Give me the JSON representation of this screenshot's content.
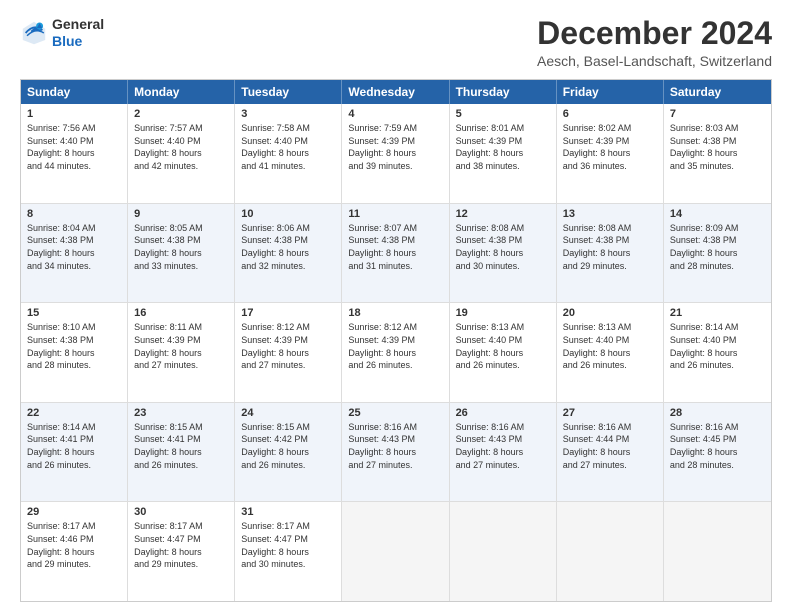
{
  "logo": {
    "line1": "General",
    "line2": "Blue"
  },
  "title": "December 2024",
  "subtitle": "Aesch, Basel-Landschaft, Switzerland",
  "weekdays": [
    "Sunday",
    "Monday",
    "Tuesday",
    "Wednesday",
    "Thursday",
    "Friday",
    "Saturday"
  ],
  "weeks": [
    [
      {
        "day": "1",
        "lines": [
          "Sunrise: 7:56 AM",
          "Sunset: 4:40 PM",
          "Daylight: 8 hours",
          "and 44 minutes."
        ]
      },
      {
        "day": "2",
        "lines": [
          "Sunrise: 7:57 AM",
          "Sunset: 4:40 PM",
          "Daylight: 8 hours",
          "and 42 minutes."
        ]
      },
      {
        "day": "3",
        "lines": [
          "Sunrise: 7:58 AM",
          "Sunset: 4:40 PM",
          "Daylight: 8 hours",
          "and 41 minutes."
        ]
      },
      {
        "day": "4",
        "lines": [
          "Sunrise: 7:59 AM",
          "Sunset: 4:39 PM",
          "Daylight: 8 hours",
          "and 39 minutes."
        ]
      },
      {
        "day": "5",
        "lines": [
          "Sunrise: 8:01 AM",
          "Sunset: 4:39 PM",
          "Daylight: 8 hours",
          "and 38 minutes."
        ]
      },
      {
        "day": "6",
        "lines": [
          "Sunrise: 8:02 AM",
          "Sunset: 4:39 PM",
          "Daylight: 8 hours",
          "and 36 minutes."
        ]
      },
      {
        "day": "7",
        "lines": [
          "Sunrise: 8:03 AM",
          "Sunset: 4:38 PM",
          "Daylight: 8 hours",
          "and 35 minutes."
        ]
      }
    ],
    [
      {
        "day": "8",
        "lines": [
          "Sunrise: 8:04 AM",
          "Sunset: 4:38 PM",
          "Daylight: 8 hours",
          "and 34 minutes."
        ]
      },
      {
        "day": "9",
        "lines": [
          "Sunrise: 8:05 AM",
          "Sunset: 4:38 PM",
          "Daylight: 8 hours",
          "and 33 minutes."
        ]
      },
      {
        "day": "10",
        "lines": [
          "Sunrise: 8:06 AM",
          "Sunset: 4:38 PM",
          "Daylight: 8 hours",
          "and 32 minutes."
        ]
      },
      {
        "day": "11",
        "lines": [
          "Sunrise: 8:07 AM",
          "Sunset: 4:38 PM",
          "Daylight: 8 hours",
          "and 31 minutes."
        ]
      },
      {
        "day": "12",
        "lines": [
          "Sunrise: 8:08 AM",
          "Sunset: 4:38 PM",
          "Daylight: 8 hours",
          "and 30 minutes."
        ]
      },
      {
        "day": "13",
        "lines": [
          "Sunrise: 8:08 AM",
          "Sunset: 4:38 PM",
          "Daylight: 8 hours",
          "and 29 minutes."
        ]
      },
      {
        "day": "14",
        "lines": [
          "Sunrise: 8:09 AM",
          "Sunset: 4:38 PM",
          "Daylight: 8 hours",
          "and 28 minutes."
        ]
      }
    ],
    [
      {
        "day": "15",
        "lines": [
          "Sunrise: 8:10 AM",
          "Sunset: 4:38 PM",
          "Daylight: 8 hours",
          "and 28 minutes."
        ]
      },
      {
        "day": "16",
        "lines": [
          "Sunrise: 8:11 AM",
          "Sunset: 4:39 PM",
          "Daylight: 8 hours",
          "and 27 minutes."
        ]
      },
      {
        "day": "17",
        "lines": [
          "Sunrise: 8:12 AM",
          "Sunset: 4:39 PM",
          "Daylight: 8 hours",
          "and 27 minutes."
        ]
      },
      {
        "day": "18",
        "lines": [
          "Sunrise: 8:12 AM",
          "Sunset: 4:39 PM",
          "Daylight: 8 hours",
          "and 26 minutes."
        ]
      },
      {
        "day": "19",
        "lines": [
          "Sunrise: 8:13 AM",
          "Sunset: 4:40 PM",
          "Daylight: 8 hours",
          "and 26 minutes."
        ]
      },
      {
        "day": "20",
        "lines": [
          "Sunrise: 8:13 AM",
          "Sunset: 4:40 PM",
          "Daylight: 8 hours",
          "and 26 minutes."
        ]
      },
      {
        "day": "21",
        "lines": [
          "Sunrise: 8:14 AM",
          "Sunset: 4:40 PM",
          "Daylight: 8 hours",
          "and 26 minutes."
        ]
      }
    ],
    [
      {
        "day": "22",
        "lines": [
          "Sunrise: 8:14 AM",
          "Sunset: 4:41 PM",
          "Daylight: 8 hours",
          "and 26 minutes."
        ]
      },
      {
        "day": "23",
        "lines": [
          "Sunrise: 8:15 AM",
          "Sunset: 4:41 PM",
          "Daylight: 8 hours",
          "and 26 minutes."
        ]
      },
      {
        "day": "24",
        "lines": [
          "Sunrise: 8:15 AM",
          "Sunset: 4:42 PM",
          "Daylight: 8 hours",
          "and 26 minutes."
        ]
      },
      {
        "day": "25",
        "lines": [
          "Sunrise: 8:16 AM",
          "Sunset: 4:43 PM",
          "Daylight: 8 hours",
          "and 27 minutes."
        ]
      },
      {
        "day": "26",
        "lines": [
          "Sunrise: 8:16 AM",
          "Sunset: 4:43 PM",
          "Daylight: 8 hours",
          "and 27 minutes."
        ]
      },
      {
        "day": "27",
        "lines": [
          "Sunrise: 8:16 AM",
          "Sunset: 4:44 PM",
          "Daylight: 8 hours",
          "and 27 minutes."
        ]
      },
      {
        "day": "28",
        "lines": [
          "Sunrise: 8:16 AM",
          "Sunset: 4:45 PM",
          "Daylight: 8 hours",
          "and 28 minutes."
        ]
      }
    ],
    [
      {
        "day": "29",
        "lines": [
          "Sunrise: 8:17 AM",
          "Sunset: 4:46 PM",
          "Daylight: 8 hours",
          "and 29 minutes."
        ]
      },
      {
        "day": "30",
        "lines": [
          "Sunrise: 8:17 AM",
          "Sunset: 4:47 PM",
          "Daylight: 8 hours",
          "and 29 minutes."
        ]
      },
      {
        "day": "31",
        "lines": [
          "Sunrise: 8:17 AM",
          "Sunset: 4:47 PM",
          "Daylight: 8 hours",
          "and 30 minutes."
        ]
      },
      {
        "day": "",
        "lines": []
      },
      {
        "day": "",
        "lines": []
      },
      {
        "day": "",
        "lines": []
      },
      {
        "day": "",
        "lines": []
      }
    ]
  ]
}
